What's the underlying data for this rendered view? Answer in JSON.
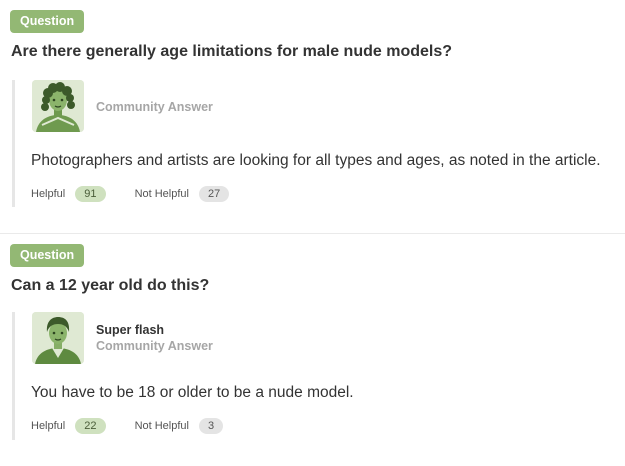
{
  "qa": [
    {
      "badge": "Question",
      "question": "Are there generally age limitations for male nude models?",
      "author_name": "",
      "author_role": "Community Answer",
      "answer": "Photographers and artists are looking for all types and ages, as noted in the article.",
      "helpful_label": "Helpful",
      "helpful_count": "91",
      "not_helpful_label": "Not Helpful",
      "not_helpful_count": "27",
      "avatar_icon": "curly-haired-person-avatar-icon"
    },
    {
      "badge": "Question",
      "question": "Can a 12 year old do this?",
      "author_name": "Super flash",
      "author_role": "Community Answer",
      "answer": "You have to be 18 or older to be a nude model.",
      "helpful_label": "Helpful",
      "helpful_count": "22",
      "not_helpful_label": "Not Helpful",
      "not_helpful_count": "3",
      "avatar_icon": "short-haired-person-avatar-icon"
    }
  ],
  "colors": {
    "accent": "#93b874",
    "avatar_bg": "#dfe9d3",
    "avatar_figure": "#6f9a4f",
    "helpful_pill": "#cfe1bf",
    "not_helpful_pill": "#e4e4e4"
  }
}
